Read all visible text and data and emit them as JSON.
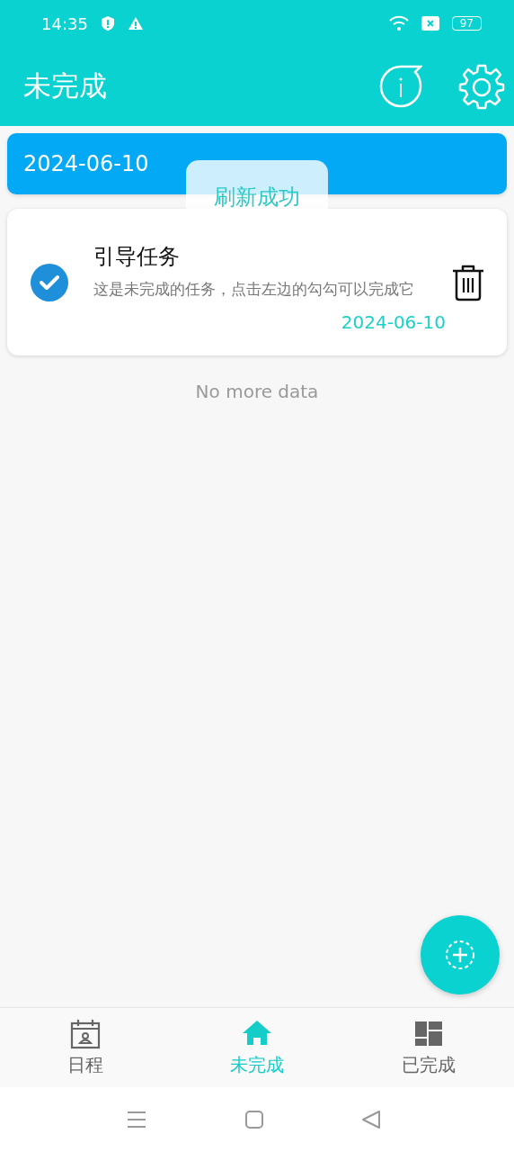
{
  "status_bar": {
    "time": "14:35",
    "battery": "97"
  },
  "header": {
    "title": "未完成"
  },
  "date_banner": {
    "date": "2024-06-10"
  },
  "toast": {
    "text": "刷新成功"
  },
  "tasks": [
    {
      "title": "引导任务",
      "description": "这是未完成的任务，点击左边的勾勾可以完成它",
      "date": "2024-06-10"
    }
  ],
  "list_footer": "No more data",
  "tabs": [
    {
      "label": "日程",
      "kind": "calendar",
      "selected": false
    },
    {
      "label": "未完成",
      "kind": "home",
      "selected": true
    },
    {
      "label": "已完成",
      "kind": "grid",
      "selected": false
    }
  ]
}
